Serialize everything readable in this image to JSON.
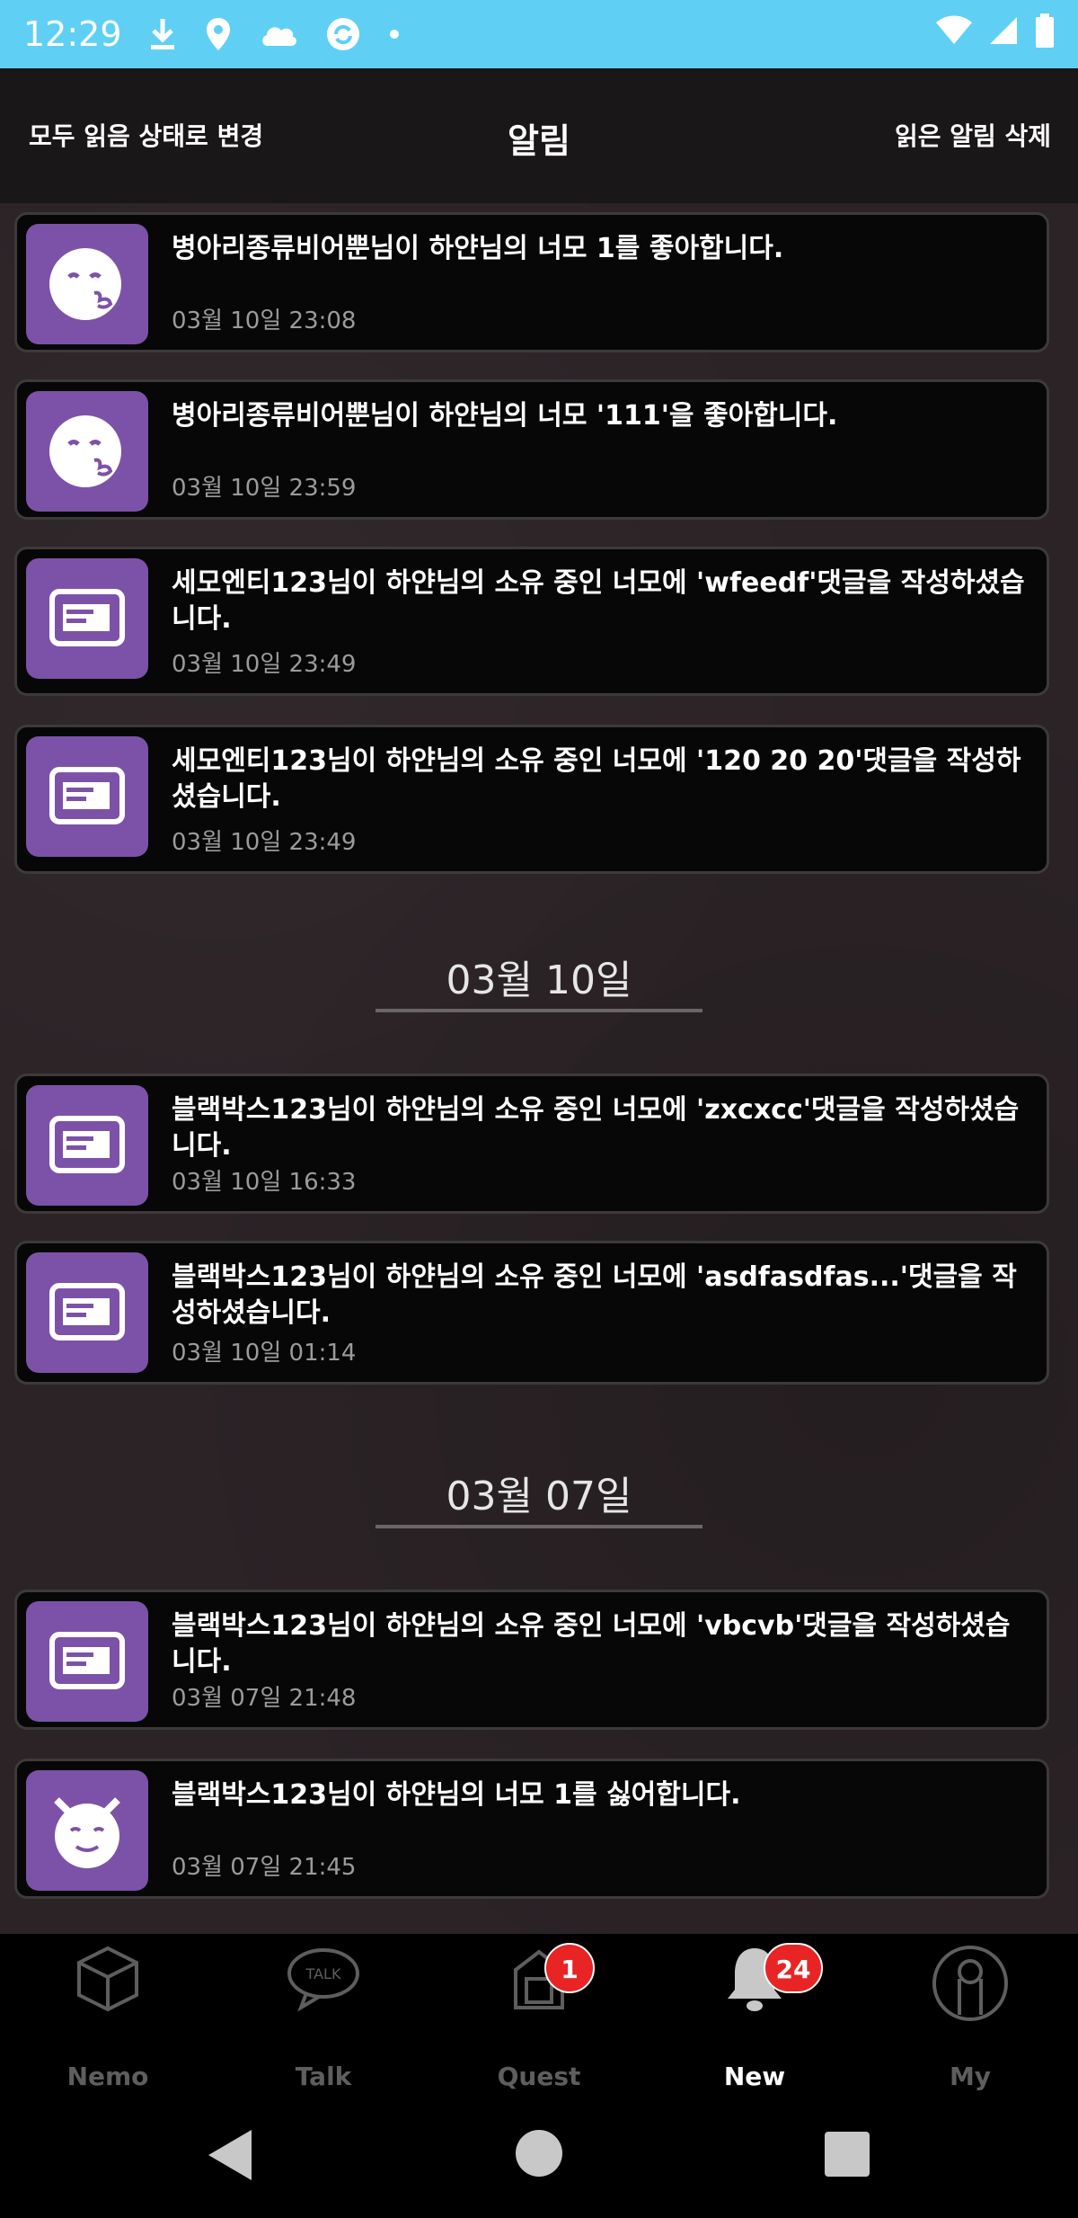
{
  "status_bar": {
    "time": "12:29",
    "icons": [
      "download-icon",
      "location-icon",
      "cloud-icon",
      "sync-icon",
      "dot-icon",
      "wifi-icon",
      "signal-icon",
      "battery-icon"
    ]
  },
  "header": {
    "left_action": "모두 읽음 상태로 변경",
    "title": "알림",
    "right_action": "읽은 알림 삭제"
  },
  "groups": [
    {
      "date": "",
      "items": [
        {
          "icon": "face-icon",
          "message": "병아리종류비어뿐님이 하얀님의 너모 1를 좋아합니다.",
          "time": "03월 10일 23:08"
        },
        {
          "icon": "face-icon",
          "message": "병아리종류비어뿐님이 하얀님의 너모 '111'을 좋아합니다.",
          "time": "03월 10일 23:59"
        },
        {
          "icon": "message-icon",
          "message": "세모엔티123님이 하얀님의 소유 중인 너모에 'wfeedf'댓글을 작성하셨습니다.",
          "time": "03월 10일 23:49"
        },
        {
          "icon": "message-icon",
          "message": "세모엔티123님이 하얀님의 소유 중인 너모에 '120 20 20'댓글을 작성하셨습니다.",
          "time": "03월 10일 23:49"
        }
      ]
    },
    {
      "date": "03월 10일",
      "items": [
        {
          "icon": "message-icon",
          "message": "블랙박스123님이 하얀님의 소유 중인 너모에 'zxcxcc'댓글을 작성하셨습니다.",
          "time": "03월 10일 16:33"
        },
        {
          "icon": "message-icon",
          "message": "블랙박스123님이 하얀님의 소유 중인 너모에 'asdfasdfas...'댓글을 작성하셨습니다.",
          "time": "03월 10일 01:14"
        }
      ]
    },
    {
      "date": "03월 07일",
      "items": [
        {
          "icon": "message-icon",
          "message": "블랙박스123님이 하얀님의 소유 중인 너모에 'vbcvb'댓글을 작성하셨습니다.",
          "time": "03월 07일 21:48"
        },
        {
          "icon": "devil-icon",
          "message": "블랙박스123님이 하얀님의 너모 1를 싫어합니다.",
          "time": "03월 07일 21:45"
        }
      ]
    }
  ],
  "nav": {
    "items": [
      {
        "label": "Nemo",
        "icon": "box-icon"
      },
      {
        "label": "Talk",
        "icon": "chat-icon"
      },
      {
        "label": "Quest",
        "icon": "quest-icon",
        "badge": "1"
      },
      {
        "label": "New",
        "icon": "bell-icon",
        "badge": "24",
        "active": true
      },
      {
        "label": "My",
        "icon": "profile-icon"
      }
    ]
  },
  "colors": {
    "accent_purple": "#7c52a8",
    "status_bar": "#5fd0f4",
    "badge_red": "#e82424"
  }
}
